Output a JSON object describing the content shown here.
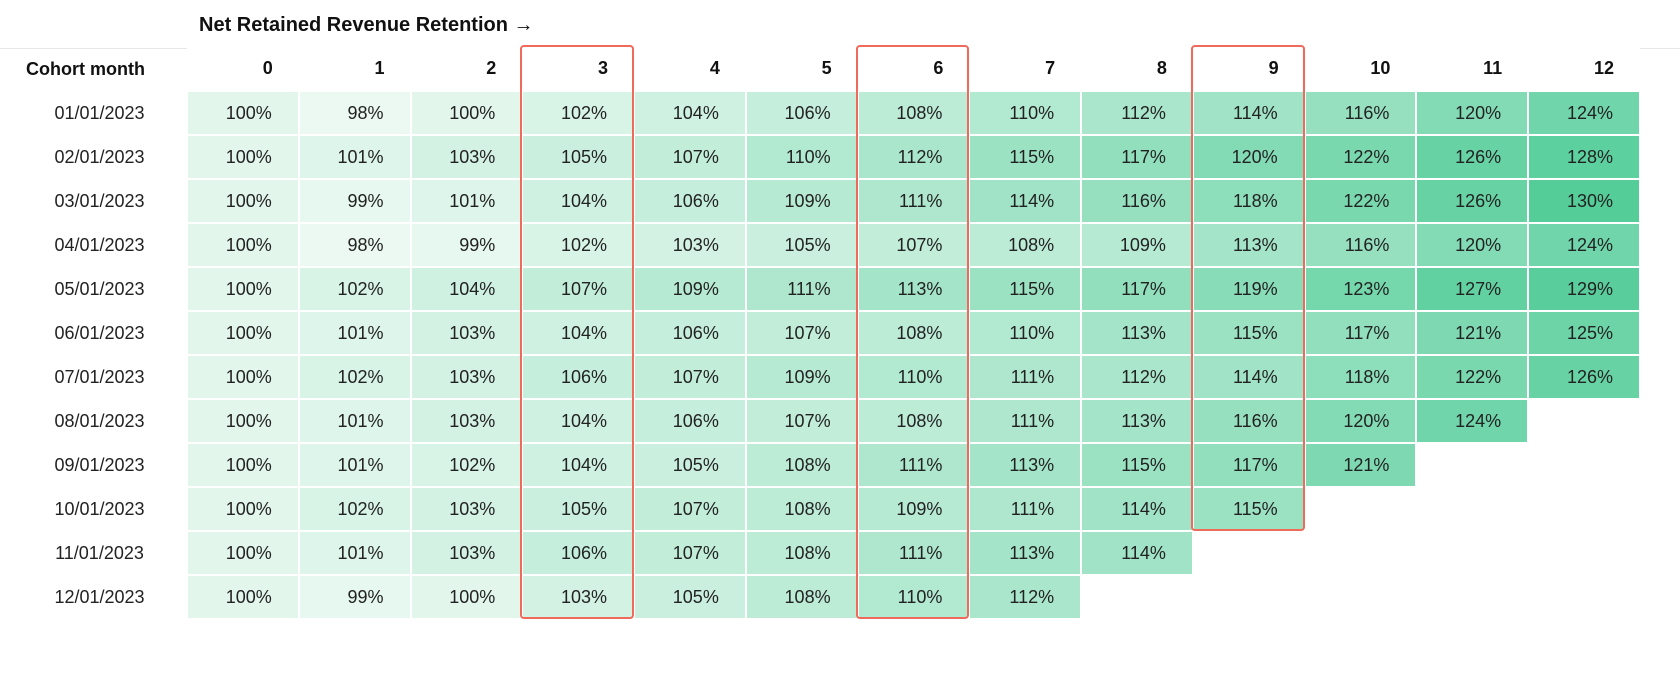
{
  "chart_data": {
    "type": "heatmap",
    "title": "Net Retained Revenue Retention →",
    "row_header_label": "Cohort month",
    "months": [
      "0",
      "1",
      "2",
      "3",
      "4",
      "5",
      "6",
      "7",
      "8",
      "9",
      "10",
      "11",
      "12"
    ],
    "cohorts": [
      {
        "label": "01/01/2023",
        "values": [
          100,
          98,
          100,
          102,
          104,
          106,
          108,
          110,
          112,
          114,
          116,
          120,
          124
        ]
      },
      {
        "label": "02/01/2023",
        "values": [
          100,
          101,
          103,
          105,
          107,
          110,
          112,
          115,
          117,
          120,
          122,
          126,
          128
        ]
      },
      {
        "label": "03/01/2023",
        "values": [
          100,
          99,
          101,
          104,
          106,
          109,
          111,
          114,
          116,
          118,
          122,
          126,
          130
        ]
      },
      {
        "label": "04/01/2023",
        "values": [
          100,
          98,
          99,
          102,
          103,
          105,
          107,
          108,
          109,
          113,
          116,
          120,
          124
        ]
      },
      {
        "label": "05/01/2023",
        "values": [
          100,
          102,
          104,
          107,
          109,
          111,
          113,
          115,
          117,
          119,
          123,
          127,
          129
        ]
      },
      {
        "label": "06/01/2023",
        "values": [
          100,
          101,
          103,
          104,
          106,
          107,
          108,
          110,
          113,
          115,
          117,
          121,
          125
        ]
      },
      {
        "label": "07/01/2023",
        "values": [
          100,
          102,
          103,
          106,
          107,
          109,
          110,
          111,
          112,
          114,
          118,
          122,
          126
        ]
      },
      {
        "label": "08/01/2023",
        "values": [
          100,
          101,
          103,
          104,
          106,
          107,
          108,
          111,
          113,
          116,
          120,
          124
        ]
      },
      {
        "label": "09/01/2023",
        "values": [
          100,
          101,
          102,
          104,
          105,
          108,
          111,
          113,
          115,
          117,
          121
        ]
      },
      {
        "label": "10/01/2023",
        "values": [
          100,
          102,
          103,
          105,
          107,
          108,
          109,
          111,
          114,
          115
        ]
      },
      {
        "label": "11/01/2023",
        "values": [
          100,
          101,
          103,
          106,
          107,
          108,
          111,
          113,
          114
        ]
      },
      {
        "label": "12/01/2023",
        "values": [
          100,
          99,
          100,
          103,
          105,
          108,
          110,
          112
        ]
      }
    ],
    "highlighted_columns": [
      3,
      6,
      9
    ],
    "value_range": {
      "min": 98,
      "max": 130
    },
    "value_suffix": "%"
  }
}
